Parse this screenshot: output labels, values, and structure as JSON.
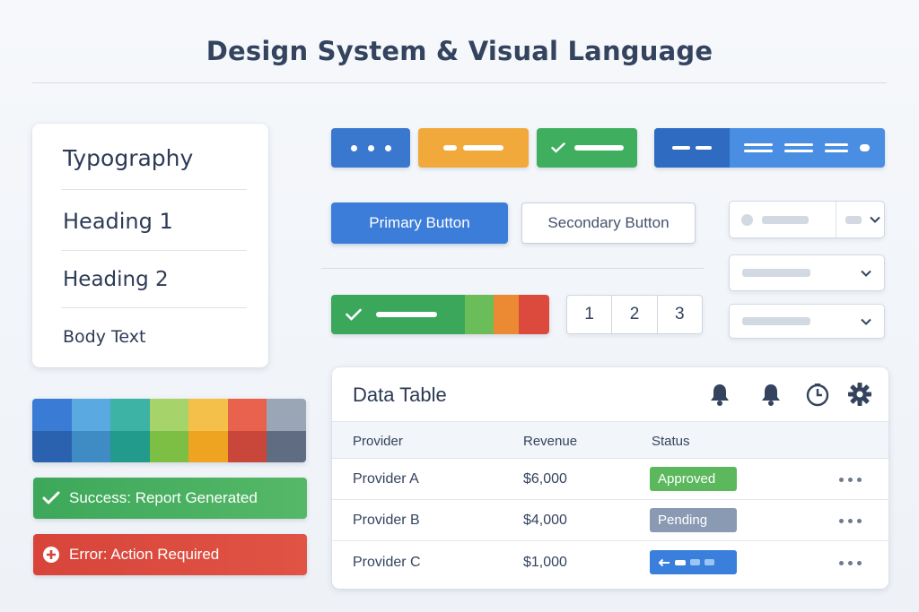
{
  "page_title": "Design System & Visual Language",
  "typography": {
    "title": "Typography",
    "heading1": "Heading 1",
    "heading2": "Heading 2",
    "body": "Body Text"
  },
  "palette": [
    {
      "top": "#3a7bd5",
      "bottom": "#2a62b0"
    },
    {
      "top": "#5aa9e0",
      "bottom": "#3f8cc4"
    },
    {
      "top": "#3db3a6",
      "bottom": "#229a8c"
    },
    {
      "top": "#a6d46a",
      "bottom": "#7cbf44"
    },
    {
      "top": "#f4c04a",
      "bottom": "#eea420"
    },
    {
      "top": "#e8624e",
      "bottom": "#c9463a"
    },
    {
      "top": "#9aa6b6",
      "bottom": "#5f6c82"
    }
  ],
  "alerts": {
    "success": "Success: Report Generated",
    "error": "Error: Action Required"
  },
  "colors": {
    "primary": "#3b7dd8",
    "orange": "#f2a93b",
    "green": "#3fae5f",
    "red": "#db4a3c",
    "slate": "#8897ad"
  },
  "buttons": {
    "primary": "Primary Button",
    "secondary": "Secondary Button"
  },
  "pagination": [
    "1",
    "2",
    "3"
  ],
  "table": {
    "title": "Data Table",
    "icons": [
      "bell-icon",
      "bell-icon",
      "clock-icon",
      "gear-icon"
    ],
    "headers": [
      "Provider",
      "Revenue",
      "Status"
    ],
    "rows": [
      {
        "provider": "Provider A",
        "revenue": "$6,000",
        "status": "Approved"
      },
      {
        "provider": "Provider B",
        "revenue": "$4,000",
        "status": "Pending"
      },
      {
        "provider": "Provider C",
        "revenue": "$1,000",
        "status": ""
      }
    ]
  }
}
